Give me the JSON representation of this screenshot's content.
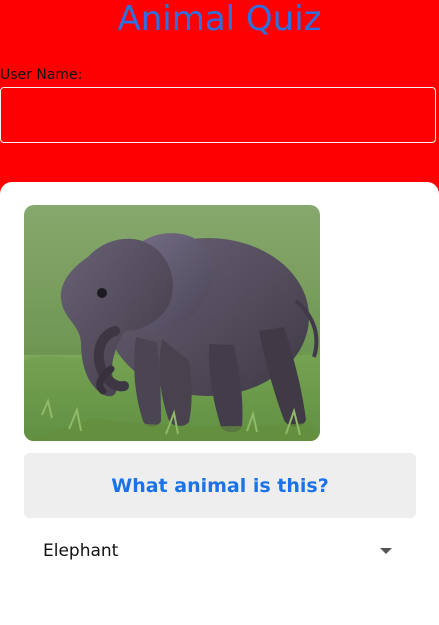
{
  "header": {
    "title": "Animal Quiz"
  },
  "user": {
    "label": "User Name:",
    "value": "",
    "placeholder": ""
  },
  "quiz": {
    "image_alt": "elephant photo",
    "question": "What animal is this?",
    "selected_answer": "Elephant",
    "dropdown_icon": "caret-down-icon"
  },
  "colors": {
    "background": "#ff0000",
    "title": "#2f6fe0",
    "question": "#1a73e8",
    "card": "#ffffff",
    "question_box": "#eeeeee"
  }
}
